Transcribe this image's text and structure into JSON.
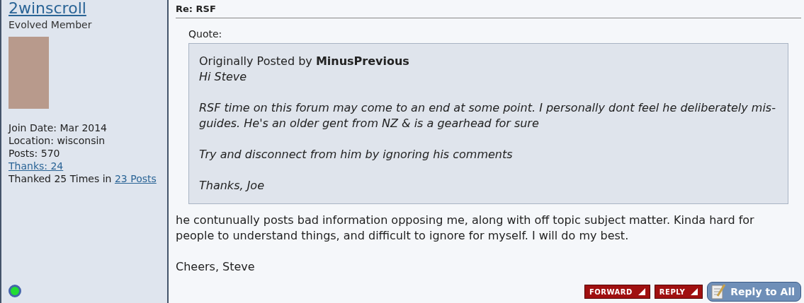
{
  "user": {
    "name": "2winscroll",
    "rank": "Evolved Member",
    "join_date": "Join Date: Mar 2014",
    "location": "Location: wisconsin",
    "posts": "Posts: 570",
    "thanks": "Thanks: 24",
    "thanked_prefix": "Thanked 25 Times in",
    "thanked_link": "23 Posts",
    "online": true
  },
  "post": {
    "title": "Re: RSF",
    "quote_label": "Quote:",
    "quote_author_prefix": "Originally Posted by",
    "quote_author": "MinusPrevious",
    "quote_paragraphs": [
      "Hi Steve",
      "RSF time on this forum may come to an end at some point. I personally dont feel he deliberately mis-guides. He's an older gent from NZ & is a gearhead for sure",
      "Try and disconnect from him by ignoring his comments",
      "Thanks, Joe"
    ],
    "body": [
      "he contunually posts bad information opposing me, along with off topic subject matter. Kinda hard for people to understand things, and difficult to ignore for myself. I will do my best.",
      "Cheers, Steve"
    ]
  },
  "buttons": [
    {
      "kind": "small",
      "label": "FORWARD"
    },
    {
      "kind": "small",
      "label": "REPLY"
    },
    {
      "kind": "big",
      "label": "Reply to All"
    }
  ]
}
